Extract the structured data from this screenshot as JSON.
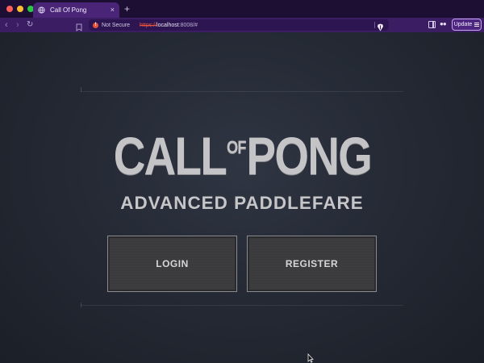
{
  "browser": {
    "tab_title": "Call Of Pong",
    "tab_close": "×",
    "new_tab": "+",
    "security_label": "Not Secure",
    "url_scheme": "https://",
    "url_host": "localhost",
    "url_rest": ":8008/#",
    "update_label": "Update",
    "accent_color": "#3b1d63"
  },
  "game": {
    "logo_left": "CALL",
    "logo_of": "OF",
    "logo_right": "PONG",
    "subtitle": "ADVANCED PADDLEFARE",
    "buttons": {
      "login": "LOGIN",
      "register": "REGISTER"
    }
  },
  "icons": [
    "globe-icon",
    "bookmark-icon",
    "warning-icon",
    "brave-shield-icon",
    "sidebar-icon",
    "wallet-icon",
    "menu-icon",
    "mouse-cursor-icon"
  ]
}
